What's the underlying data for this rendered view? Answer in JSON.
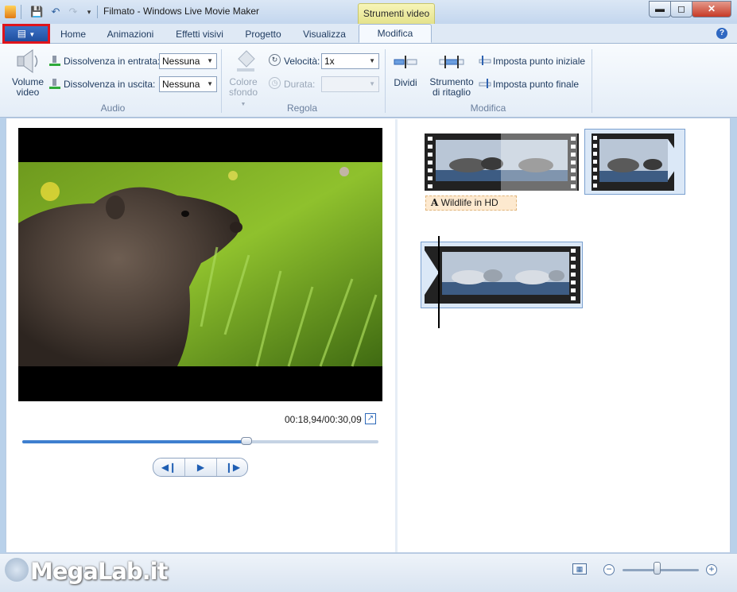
{
  "window": {
    "title": "Filmato - Windows Live Movie Maker",
    "context_tab": "Strumenti video"
  },
  "tabs": [
    {
      "label": "Home"
    },
    {
      "label": "Animazioni"
    },
    {
      "label": "Effetti visivi"
    },
    {
      "label": "Progetto"
    },
    {
      "label": "Visualizza"
    },
    {
      "label": "Modifica",
      "active": true
    }
  ],
  "ribbon": {
    "audio": {
      "label": "Audio",
      "volume_label": "Volume video",
      "fade_in_label": "Dissolvenza in entrata:",
      "fade_in_value": "Nessuna",
      "fade_out_label": "Dissolvenza in uscita:",
      "fade_out_value": "Nessuna"
    },
    "regola": {
      "label": "Regola",
      "bg_color_label": "Colore sfondo",
      "speed_label": "Velocità:",
      "speed_value": "1x",
      "duration_label": "Durata:",
      "duration_value": ""
    },
    "modifica": {
      "label": "Modifica",
      "split_label": "Dividi",
      "trim_label": "Strumento di ritaglio",
      "set_start_label": "Imposta punto iniziale",
      "set_end_label": "Imposta punto finale"
    }
  },
  "preview": {
    "timecode": "00:18,94/00:30,09",
    "progress": 0.63
  },
  "storyboard": {
    "caption_text": "Wildlife in HD",
    "caption_icon": "A"
  },
  "statusbar": {
    "watermark": "MegaLab.it",
    "zoom_level": 0.45
  },
  "colors": {
    "accent": "#3f7fcf",
    "highlight": "#e0141c"
  }
}
